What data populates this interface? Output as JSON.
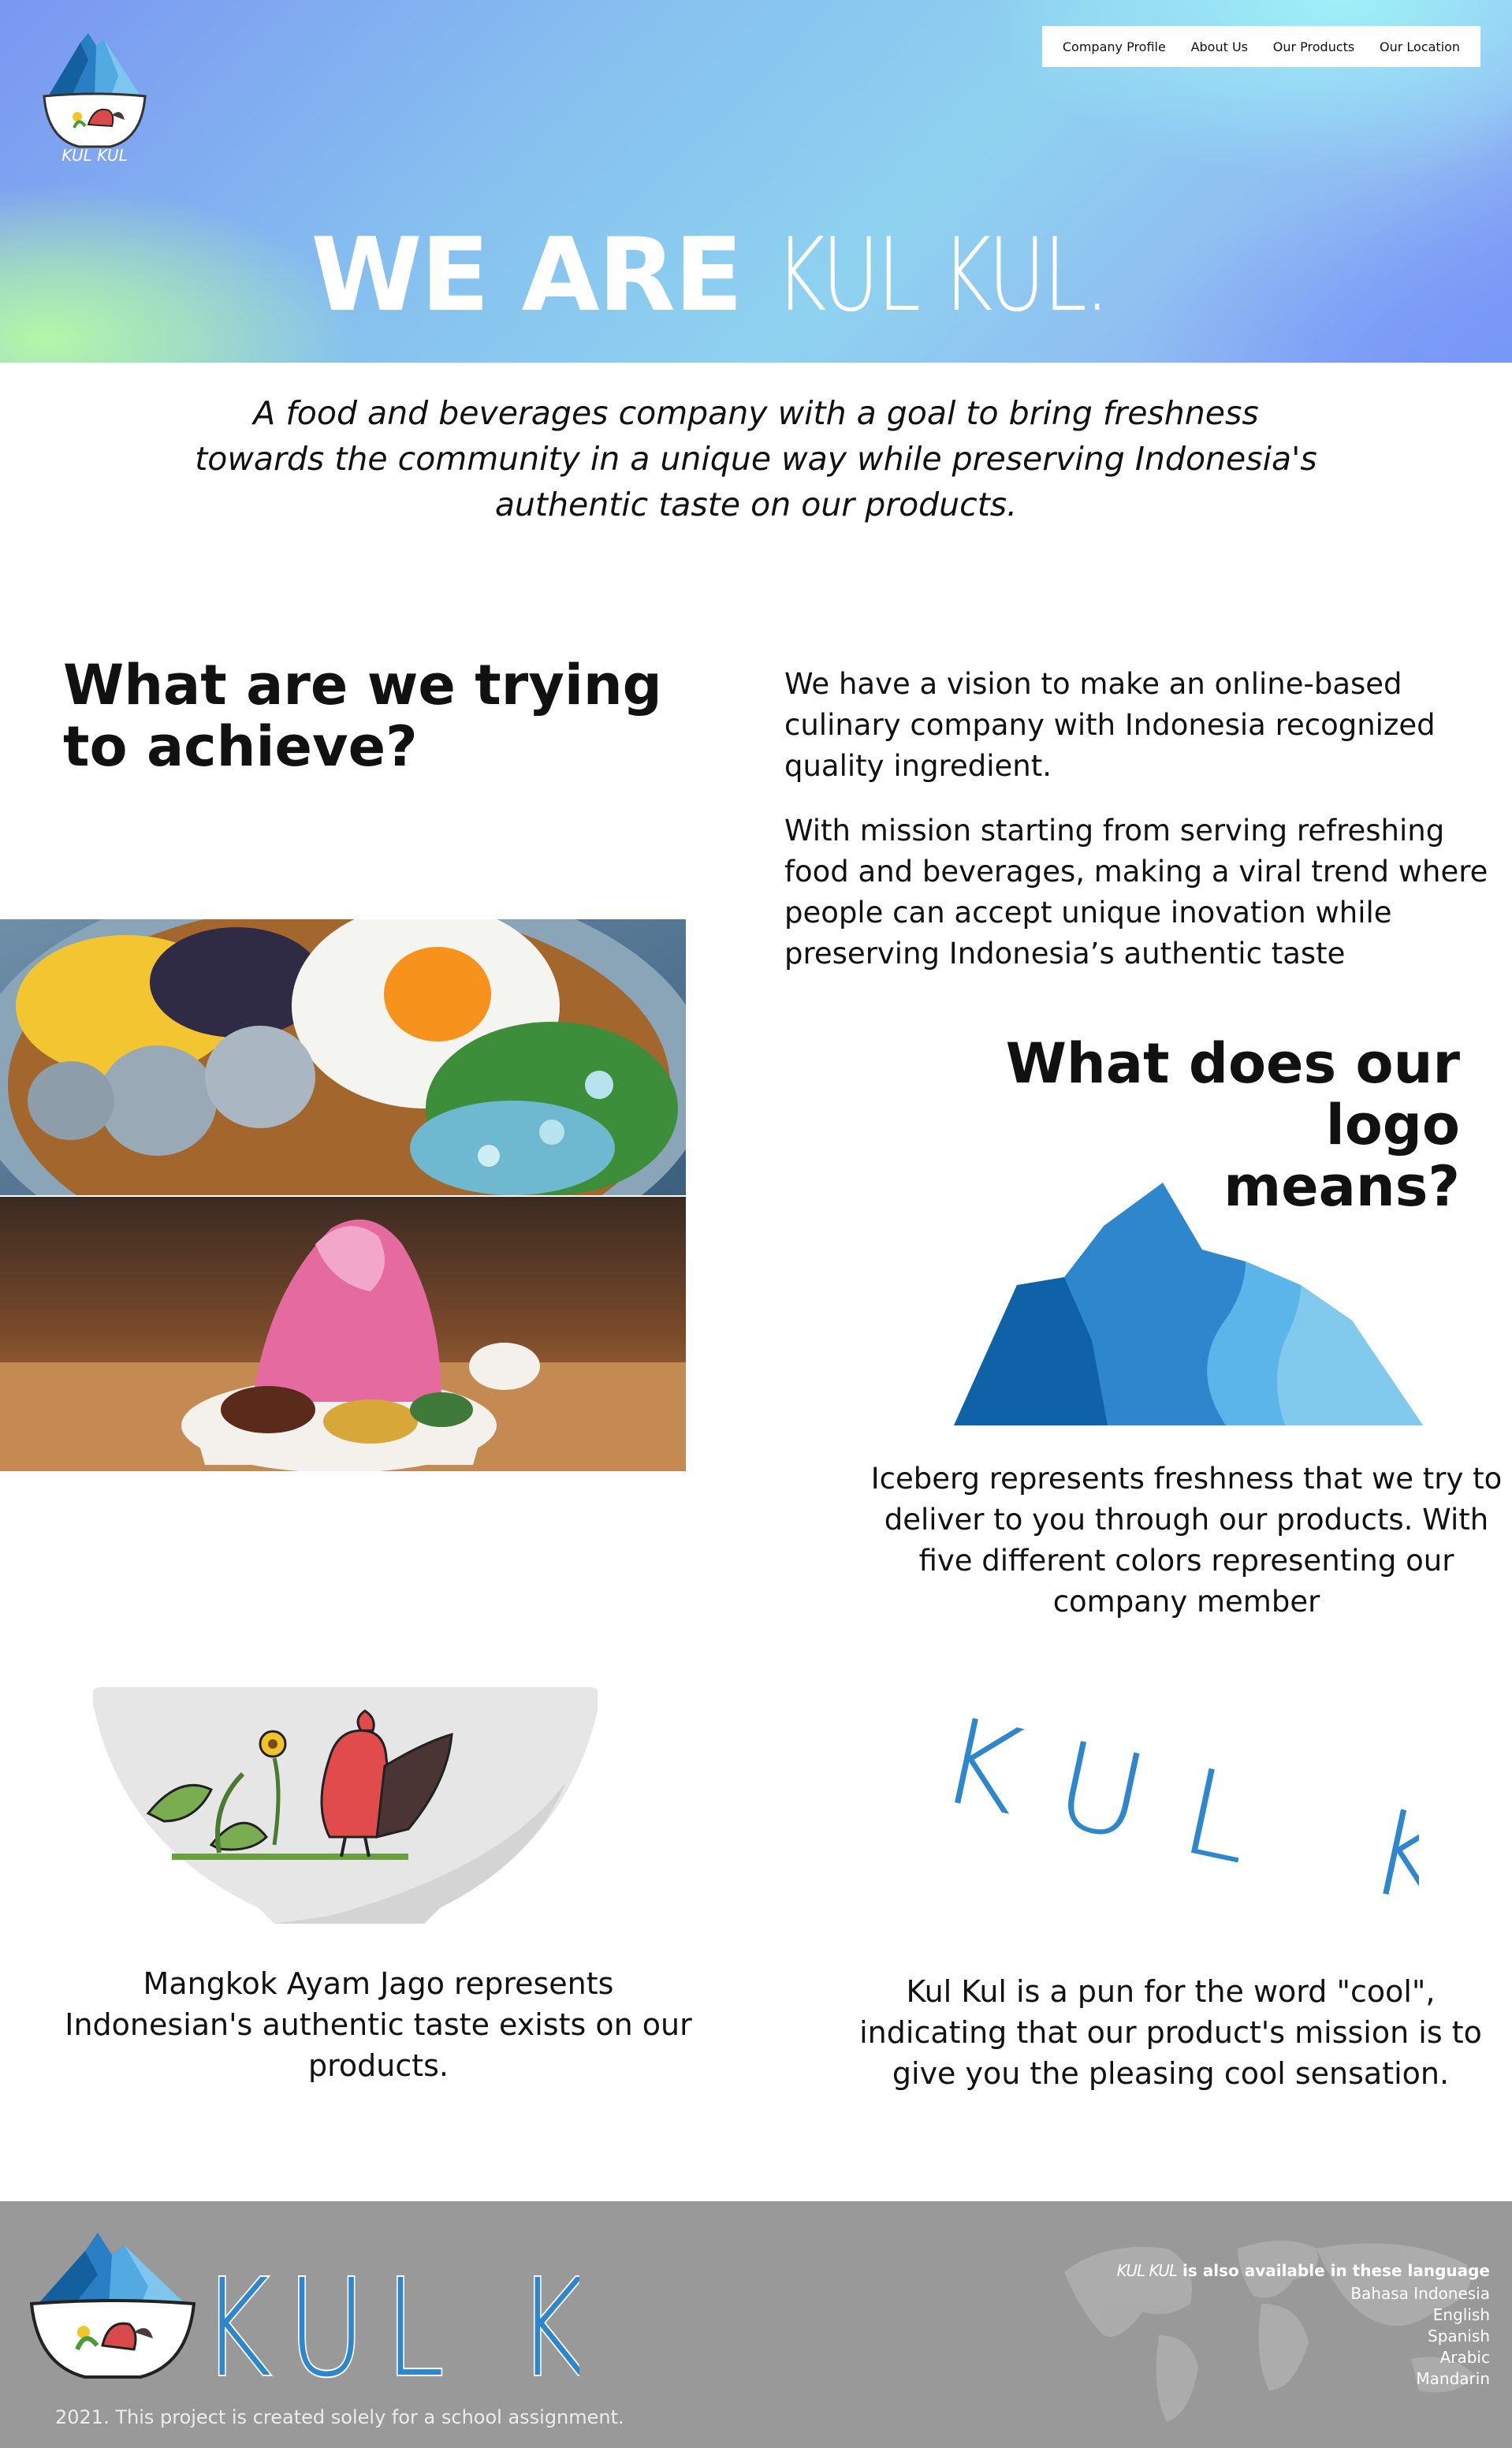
{
  "nav": {
    "items": [
      "Company Profile",
      "About Us",
      "Our Products",
      "Our Location"
    ]
  },
  "hero": {
    "title_prefix": "WE ARE ",
    "title_brand": "KUL KUL.",
    "logo_text": "KUL KUL"
  },
  "tagline": "A food and beverages company with a goal to bring freshness towards the community in a unique way while preserving Indonesia's authentic taste on our products.",
  "achieve": {
    "heading_line1": "What are we trying",
    "heading_to": "to ",
    "heading_bold": "achieve",
    "heading_end": "?",
    "vision": "We have a vision to make an online-based culinary company with Indonesia recognized quality ingredient.",
    "mission": "With mission starting from serving refreshing food and beverages, making a viral trend where people can accept unique inovation while preserving Indonesia’s authentic taste"
  },
  "logo_section": {
    "heading_line1": "What does our logo",
    "heading_bold": "means",
    "heading_end": "?",
    "iceberg_text": "Iceberg represents freshness that we try to deliver to you through our products. With five different colors representing our company member",
    "bowl_text": "Mangkok Ayam Jago represents Indonesian's authentic taste exists on our products.",
    "wordmark_text": "KUL KUL",
    "pun_text": "Kul Kul is a pun for the word \"cool\", indicating that our product's mission is to give you the pleasing cool sensation."
  },
  "footer": {
    "brand": "KUL KUL",
    "note": "2021. This project is created solely for a school assignment.",
    "lang_brand": "KUL KUL",
    "lang_heading": " is also available in these language",
    "languages": [
      "Bahasa Indonesia",
      "English",
      "Spanish",
      "Arabic",
      "Mandarin"
    ]
  },
  "colors": {
    "iceberg_dark": "#0f62a8",
    "iceberg_mid": "#2e86cc",
    "iceberg_light": "#5bb4ea",
    "iceberg_pale": "#82c9ee",
    "footer_bg": "#999999"
  }
}
